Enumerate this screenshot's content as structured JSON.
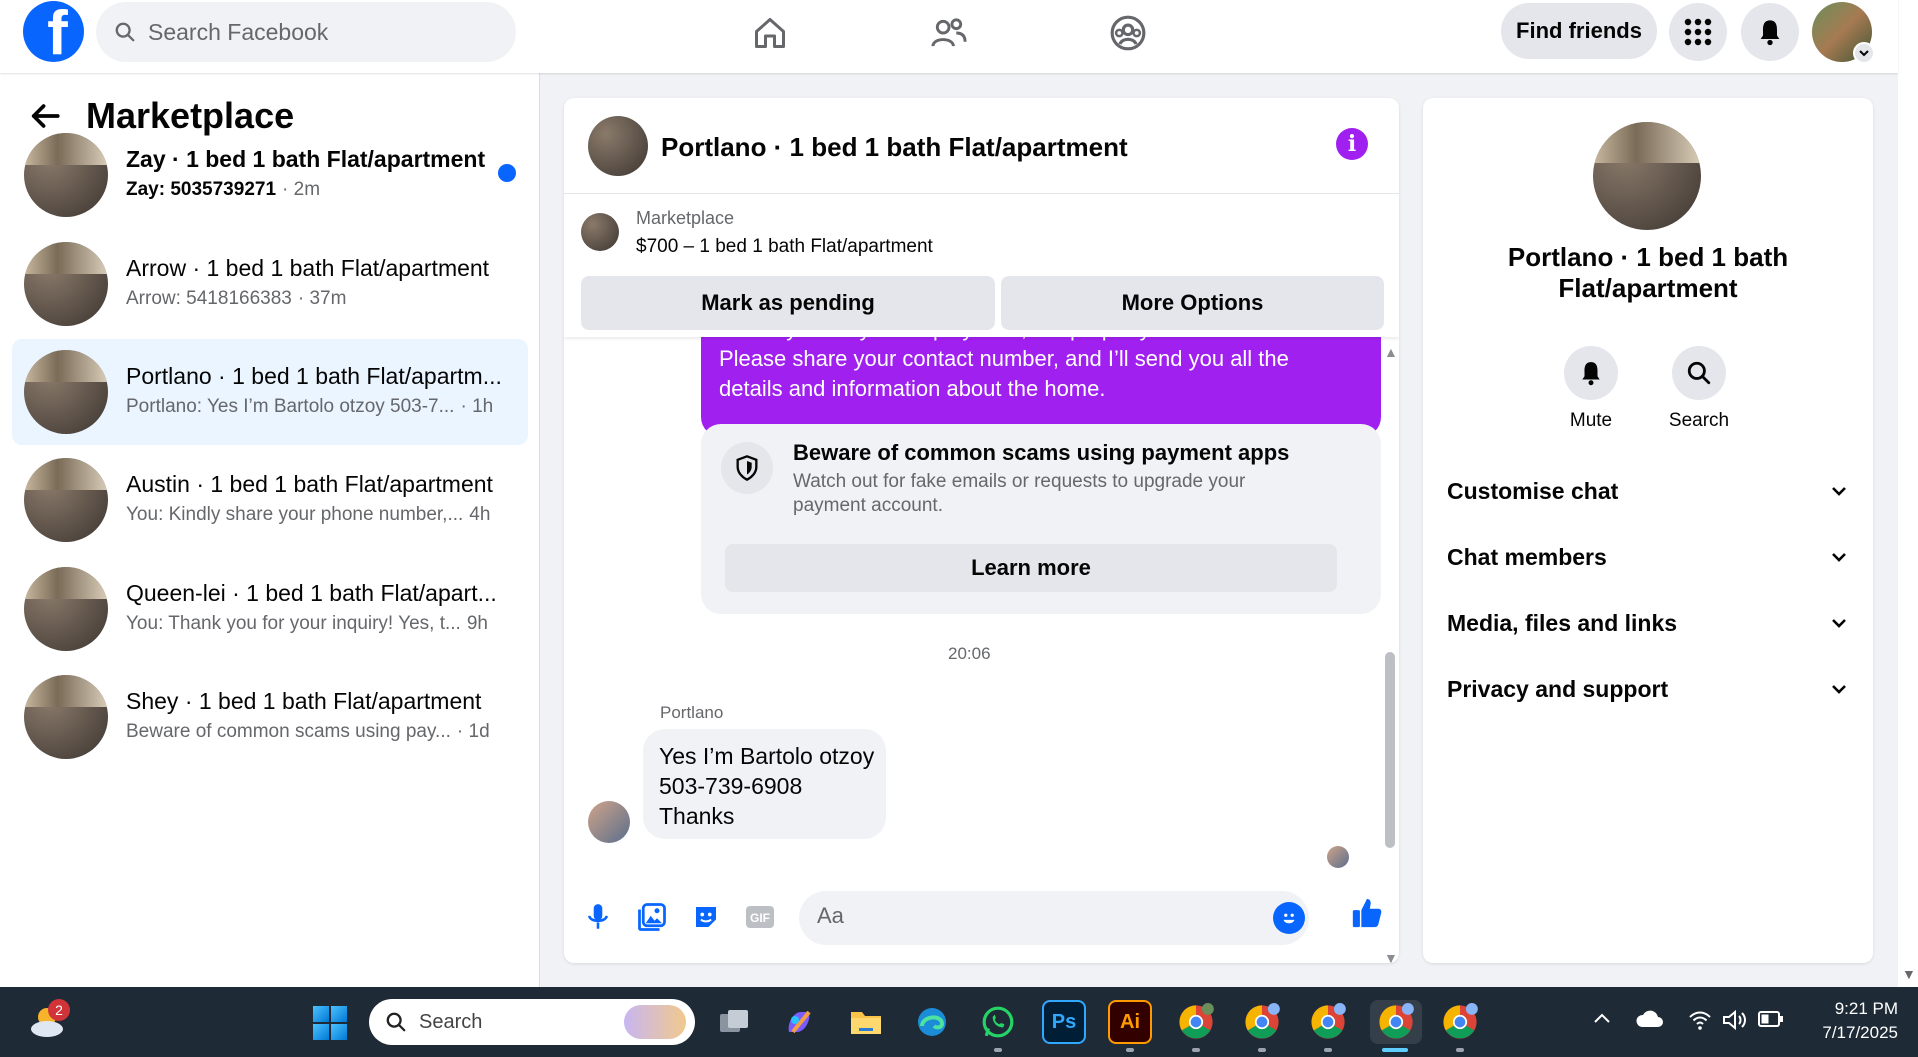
{
  "topbar": {
    "logo": "f",
    "search_placeholder": "Search Facebook",
    "find_friends": "Find friends",
    "nav_icons": [
      "home-icon",
      "friends-icon",
      "groups-icon"
    ]
  },
  "sidebar": {
    "title": "Marketplace",
    "conversations": [
      {
        "title": "Zay · 1 bed 1 bath Flat/apartment",
        "snippet": "Zay: 5035739271",
        "time": "· 2m",
        "unread": true
      },
      {
        "title": "Arrow · 1 bed 1 bath Flat/apartment",
        "snippet": "Arrow: 5418166383",
        "time": "· 37m",
        "unread": false
      },
      {
        "title": "Portlano · 1 bed 1 bath Flat/apartm...",
        "snippet": "Portlano: Yes I’m Bartolo otzoy 503-7...",
        "time": "· 1h",
        "unread": false,
        "active": true
      },
      {
        "title": "Austin · 1 bed 1 bath Flat/apartment",
        "snippet": "You: Kindly share your phone number,...",
        "time": "4h",
        "unread": false
      },
      {
        "title": "Queen-lei · 1 bed 1 bath Flat/apart...",
        "snippet": "You: Thank you for your inquiry! Yes, t...",
        "time": "9h",
        "unread": false
      },
      {
        "title": "Shey · 1 bed 1 bath Flat/apartment",
        "snippet": "Beware of common scams using pay...",
        "time": "· 1d",
        "unread": false
      }
    ]
  },
  "chat": {
    "title": "Portlano · 1 bed 1 bath Flat/apartment",
    "marketplace_label": "Marketplace",
    "listing": "$700 – 1 bed 1 bath Flat/apartment",
    "mark_pending": "Mark as pending",
    "more_options": "More Options",
    "outgoing_top_line": "Thank you for your inquiry! Yes, the property is still available.",
    "outgoing_line2": "Please share your contact number, and I’ll send you all the",
    "outgoing_line3": "details and information about the home.",
    "scam_title": "Beware of common scams using payment apps",
    "scam_text": "Watch out for fake emails or requests to upgrade your payment account.",
    "learn_more": "Learn more",
    "timestamp": "20:06",
    "sender_name": "Portlano",
    "incoming_lines": [
      "Yes I’m Bartolo otzoy",
      "503-739-6908",
      "Thanks"
    ],
    "composer_placeholder": "Aa"
  },
  "info_panel": {
    "title": "Portlano · 1 bed 1 bath Flat/apartment",
    "mute": "Mute",
    "search": "Search",
    "sections": [
      "Customise chat",
      "Chat members",
      "Media, files and links",
      "Privacy and support"
    ]
  },
  "taskbar": {
    "weather_badge": "2",
    "search_placeholder": "Search",
    "time": "9:21 PM",
    "date": "7/17/2025",
    "apps": [
      "Ps",
      "Ai"
    ]
  },
  "colors": {
    "facebook_blue": "#0866ff",
    "messenger_purple": "#a020f0",
    "active_row": "#ebf5ff"
  }
}
